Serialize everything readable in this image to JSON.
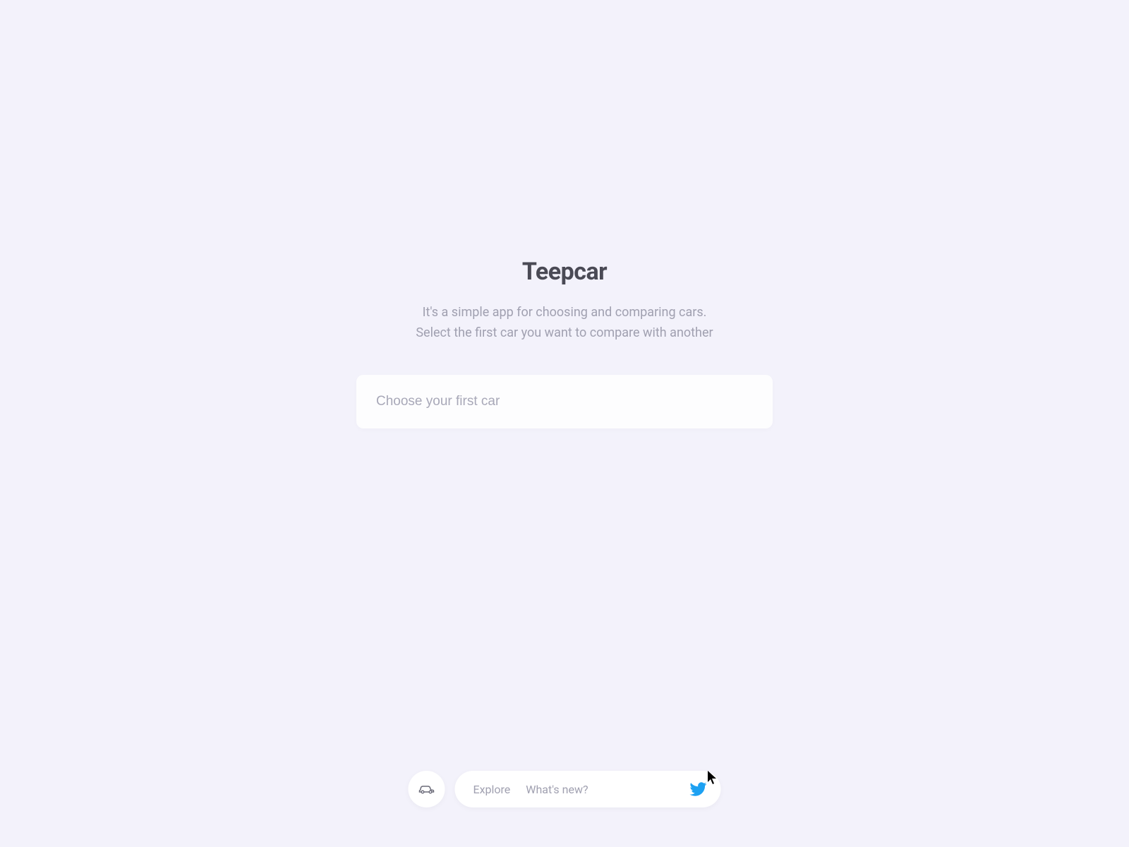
{
  "header": {
    "title": "Teepcar",
    "subtitle_line1": "It's a simple app for choosing and comparing cars.",
    "subtitle_line2": "Select the first car you want to compare with another"
  },
  "input": {
    "placeholder": "Choose your first car",
    "value": ""
  },
  "bottom_nav": {
    "logo_icon": "car-icon",
    "links": [
      {
        "label": "Explore"
      },
      {
        "label": "What's new?"
      }
    ],
    "social_icon": "twitter-icon"
  },
  "colors": {
    "background": "#f3f2fb",
    "title": "#4a4a55",
    "subtitle": "#a0a0b0",
    "input_bg": "#fdfdfe",
    "placeholder": "#a8a8b8",
    "twitter": "#1da1f2",
    "car_icon": "#6b6b78"
  }
}
